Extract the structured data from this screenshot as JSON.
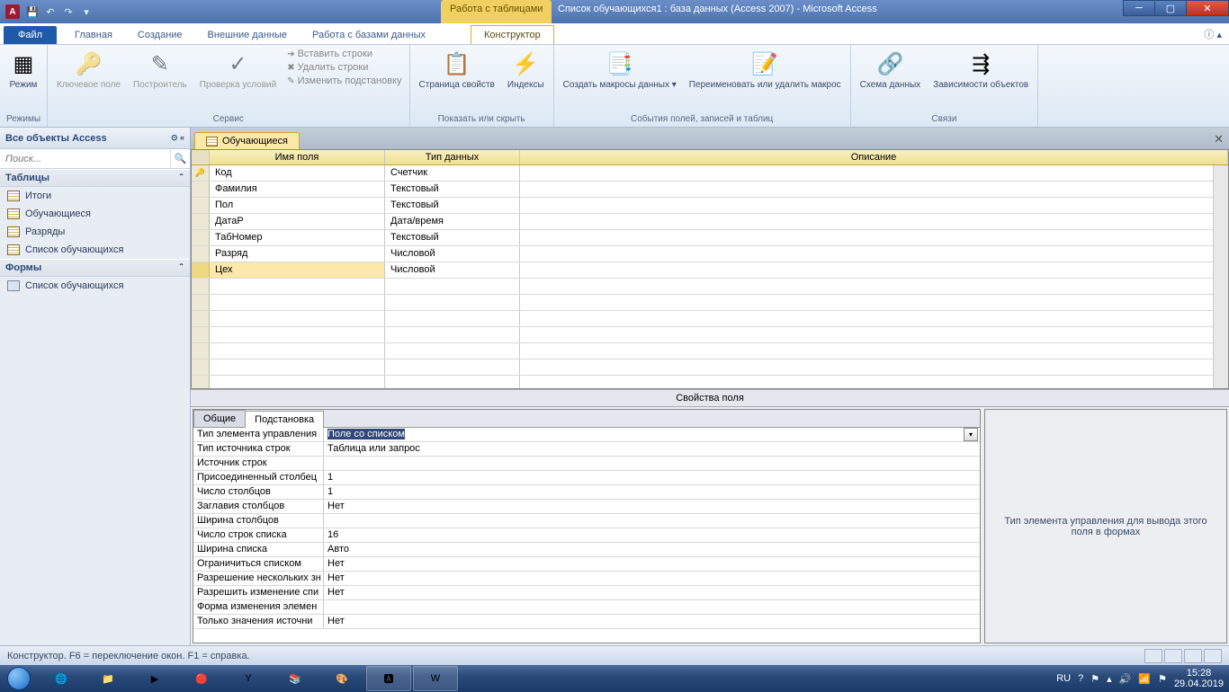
{
  "titlebar": {
    "context_tab": "Работа с таблицами",
    "title": "Список обучающихся1 : база данных (Access 2007) - Microsoft Access"
  },
  "tabs": {
    "file": "Файл",
    "items": [
      "Главная",
      "Создание",
      "Внешние данные",
      "Работа с базами данных"
    ],
    "context": "Конструктор"
  },
  "ribbon": {
    "g1": {
      "label": "Режимы",
      "btn": "Режим"
    },
    "g2": {
      "label": "Сервис",
      "b1": "Ключевое\nполе",
      "b2": "Построитель",
      "b3": "Проверка\nусловий",
      "s1": "Вставить строки",
      "s2": "Удалить строки",
      "s3": "Изменить подстановку"
    },
    "g3": {
      "label": "Показать или скрыть",
      "b1": "Страница\nсвойств",
      "b2": "Индексы"
    },
    "g4": {
      "label": "События полей, записей и таблиц",
      "b1": "Создать макросы\nданных ▾",
      "b2": "Переименовать\nили удалить макрос"
    },
    "g5": {
      "label": "Связи",
      "b1": "Схема\nданных",
      "b2": "Зависимости\nобъектов"
    }
  },
  "nav": {
    "header": "Все объекты Access",
    "search_placeholder": "Поиск...",
    "sec_tables": "Таблицы",
    "tables": [
      "Итоги",
      "Обучающиеся",
      "Разряды",
      "Список обучающихся"
    ],
    "sec_forms": "Формы",
    "forms": [
      "Список обучающихся"
    ]
  },
  "design": {
    "tab": "Обучающиеся",
    "cols": {
      "name": "Имя поля",
      "type": "Тип данных",
      "desc": "Описание"
    },
    "rows": [
      {
        "name": "Код",
        "type": "Счетчик",
        "key": true
      },
      {
        "name": "Фамилия",
        "type": "Текстовый"
      },
      {
        "name": "Пол",
        "type": "Текстовый"
      },
      {
        "name": "ДатаР",
        "type": "Дата/время"
      },
      {
        "name": "ТабНомер",
        "type": "Текстовый"
      },
      {
        "name": "Разряд",
        "type": "Числовой"
      },
      {
        "name": "Цех",
        "type": "Числовой",
        "selected": true
      }
    ]
  },
  "props": {
    "title": "Свойства поля",
    "tab_general": "Общие",
    "tab_lookup": "Подстановка",
    "rows": [
      {
        "l": "Тип элемента управления",
        "v": "Поле со списком",
        "hi": true
      },
      {
        "l": "Тип источника строк",
        "v": "Таблица или запрос"
      },
      {
        "l": "Источник строк",
        "v": ""
      },
      {
        "l": "Присоединенный столбец",
        "v": "1"
      },
      {
        "l": "Число столбцов",
        "v": "1"
      },
      {
        "l": "Заглавия столбцов",
        "v": "Нет"
      },
      {
        "l": "Ширина столбцов",
        "v": ""
      },
      {
        "l": "Число строк списка",
        "v": "16"
      },
      {
        "l": "Ширина списка",
        "v": "Авто"
      },
      {
        "l": "Ограничиться списком",
        "v": "Нет"
      },
      {
        "l": "Разрешение нескольких зн",
        "v": "Нет"
      },
      {
        "l": "Разрешить изменение спи",
        "v": "Нет"
      },
      {
        "l": "Форма изменения элемен",
        "v": ""
      },
      {
        "l": "Только значения источни",
        "v": "Нет"
      }
    ],
    "help": "Тип элемента управления для вывода этого поля в формах"
  },
  "status": {
    "text": "Конструктор.  F6 = переключение окон.  F1 = справка."
  },
  "tray": {
    "lang": "RU",
    "time": "15:28",
    "date": "29.04.2019"
  }
}
